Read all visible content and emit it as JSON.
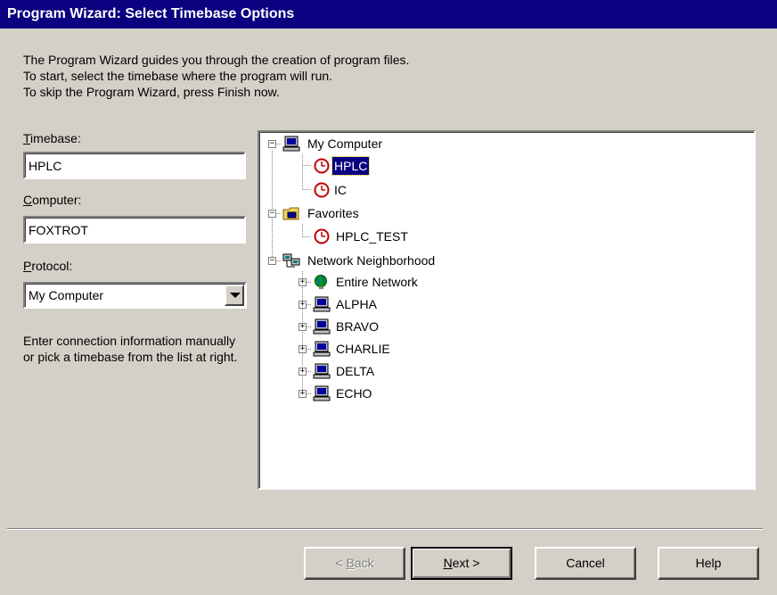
{
  "window": {
    "title": "Program Wizard: Select Timebase Options"
  },
  "intro": {
    "line1": "The Program Wizard guides you through the creation of program files.",
    "line2": "To start, select the timebase where the program will run.",
    "line3": "To skip the Program Wizard, press Finish now."
  },
  "form": {
    "timebase_label_mnemonic": "T",
    "timebase_label_rest": "imebase:",
    "timebase_value": "HPLC",
    "computer_label_mnemonic": "C",
    "computer_label_rest": "omputer:",
    "computer_value": "FOXTROT",
    "protocol_label_mnemonic": "P",
    "protocol_label_rest": "rotocol:",
    "protocol_value": "My Computer",
    "help_text": "Enter connection information manually or pick a timebase from the list at right."
  },
  "tree": {
    "my_computer": "My Computer",
    "hplc": "HPLC",
    "ic": "IC",
    "favorites": "Favorites",
    "hplc_test": "HPLC_TEST",
    "network": "Network Neighborhood",
    "entire_network": "Entire Network",
    "alpha": "ALPHA",
    "bravo": "BRAVO",
    "charlie": "CHARLIE",
    "delta": "DELTA",
    "echo": "ECHO",
    "selected": "HPLC"
  },
  "buttons": {
    "back_mnemonic": "B",
    "back_prefix": "< ",
    "back_rest": "ack",
    "next_mnemonic": "N",
    "next_rest": "ext >",
    "cancel": "Cancel",
    "help": "Help"
  },
  "icons": {
    "computer": "computer-icon",
    "clock": "timebase-clock-icon",
    "favorites": "favorites-folder-icon",
    "network": "network-neighborhood-icon",
    "globe": "globe-icon"
  },
  "colors": {
    "titlebar": "#0a0080",
    "dialog": "#d4d0c8",
    "selection": "#0a0080",
    "clock_ring": "#c00000"
  }
}
